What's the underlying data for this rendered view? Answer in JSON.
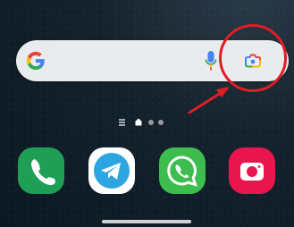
{
  "screen": {
    "type": "android-home-screen",
    "background_color": "#14222d"
  },
  "search_widget": {
    "logo_icon": "google-g-icon",
    "mic_icon": "microphone-icon",
    "lens_icon": "google-lens-camera-icon",
    "background_color": "#e9ebee"
  },
  "annotation": {
    "shape": "circle-with-arrow",
    "target": "google-lens-camera-icon",
    "color": "#e11d25"
  },
  "page_indicator": {
    "items": [
      "lines-menu",
      "home",
      "dot",
      "dot"
    ],
    "active": "home"
  },
  "dock": {
    "apps": [
      {
        "icon": "phone-icon",
        "color": "#1f9e55"
      },
      {
        "icon": "telegram-icon",
        "color": "#2ca5e0"
      },
      {
        "icon": "whatsapp-icon",
        "color": "#3dbd4d"
      },
      {
        "icon": "camera-icon",
        "color": "#e8154f"
      }
    ]
  },
  "navigation": {
    "gesture_handle": true
  }
}
